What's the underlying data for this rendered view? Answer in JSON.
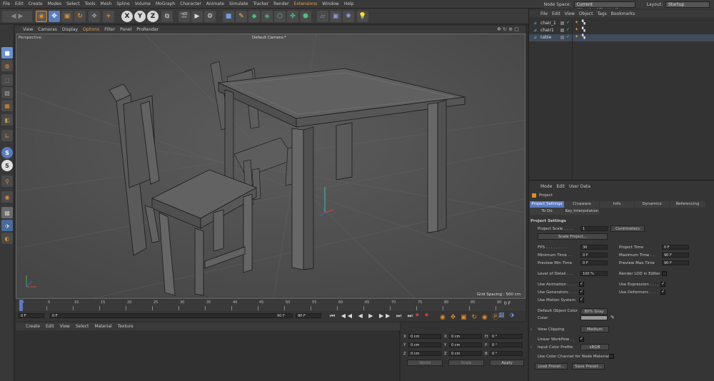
{
  "menubar": {
    "items": [
      "File",
      "Edit",
      "Create",
      "Modes",
      "Select",
      "Tools",
      "Mesh",
      "Spline",
      "Volume",
      "MoGraph",
      "Character",
      "Animate",
      "Simulate",
      "Tracker",
      "Render",
      "Extensions",
      "Window",
      "Help"
    ],
    "node_space_label": "Node Space:",
    "node_space_value": "Current (Standard/Physical)",
    "layout_label": "Layout:",
    "layout_value": "Startup"
  },
  "toolbar": {
    "x": "X",
    "y": "Y",
    "z": "Z"
  },
  "viewport": {
    "menu": [
      "View",
      "Cameras",
      "Display",
      "Options",
      "Filter",
      "Panel",
      "ProRender"
    ],
    "view_name": "Perspective",
    "camera_name": "Default Camera:*",
    "grid_spacing": "Grid Spacing : 500 cm"
  },
  "timeline": {
    "ticks": [
      "0",
      "5",
      "10",
      "15",
      "20",
      "25",
      "30",
      "35",
      "40",
      "45",
      "50",
      "55",
      "60",
      "65",
      "70",
      "75",
      "80",
      "85",
      "90"
    ],
    "current_frame": "0 F",
    "start": "0 F",
    "end": "90 F",
    "end2": "90 F",
    "frame_readout": "0 F"
  },
  "material_menu": [
    "Create",
    "Edit",
    "View",
    "Select",
    "Material",
    "Texture"
  ],
  "coords": {
    "x_label": "X",
    "y_label": "Y",
    "z_label": "Z",
    "pos_x": "0 cm",
    "pos_y": "0 cm",
    "pos_z": "0 cm",
    "size_x": "0 cm",
    "size_y": "0 cm",
    "size_z": "0 cm",
    "h_label": "H",
    "p_label": "P",
    "b_label": "B",
    "rot_h": "0 °",
    "rot_p": "0 °",
    "rot_b": "0 °",
    "world": "World",
    "scale": "Scale",
    "apply": "Apply"
  },
  "object_manager": {
    "menu": [
      "File",
      "Edit",
      "View",
      "Object",
      "Tags",
      "Bookmarks"
    ],
    "objects": [
      "chair_1",
      "chair1",
      "table"
    ]
  },
  "attributes": {
    "menu": [
      "Mode",
      "Edit",
      "User Data"
    ],
    "title": "Project",
    "tabs_row1": [
      "Project Settings",
      "Cinaware",
      "Info",
      "Dynamics",
      "Referencing"
    ],
    "tabs_row2": [
      "To Do",
      "Key Interpolation"
    ],
    "section": "Project Settings",
    "project_scale_label": "Project Scale . . . .",
    "project_scale_value": "1",
    "project_scale_unit": "Centimeters",
    "scale_project_btn": "Scale Project...",
    "fps_label": "FPS . . . . . . . . .",
    "fps_value": "30",
    "project_time_label": "Project Time",
    "project_time_value": "0 F",
    "min_time_label": "Minimum Time . .",
    "min_time_value": "0 F",
    "max_time_label": "Maximum Time . .",
    "max_time_value": "90 F",
    "prev_min_label": "Preview Min Time",
    "prev_min_value": "0 F",
    "prev_max_label": "Preview Max Time",
    "prev_max_value": "90 F",
    "lod_label": "Level of Detail . . .",
    "lod_value": "100 %",
    "render_lod_label": "Render LOD in Editor",
    "use_anim": "Use Animation . . . .",
    "use_expr": "Use Expression . . . .",
    "use_gen": "Use Generators . . . .",
    "use_def": "Use Deformers . . . .",
    "use_motion": "Use Motion System",
    "default_color_label": "Default Object Color",
    "default_color_value": "80% Gray",
    "color_label": "Color",
    "view_clipping_label": "View Clipping",
    "view_clipping_value": "Medium",
    "linear_workflow": "Linear Workflow . .",
    "input_color_label": "Input Color Profile",
    "input_color_value": "sRGB",
    "use_color_channel": "Use Color Channel for Node Material",
    "load_preset": "Load Preset...",
    "save_preset": "Save Preset..."
  },
  "colors": {
    "accent": "#5a7bbf",
    "viewport_bg": "#555555",
    "panel": "#333333"
  }
}
